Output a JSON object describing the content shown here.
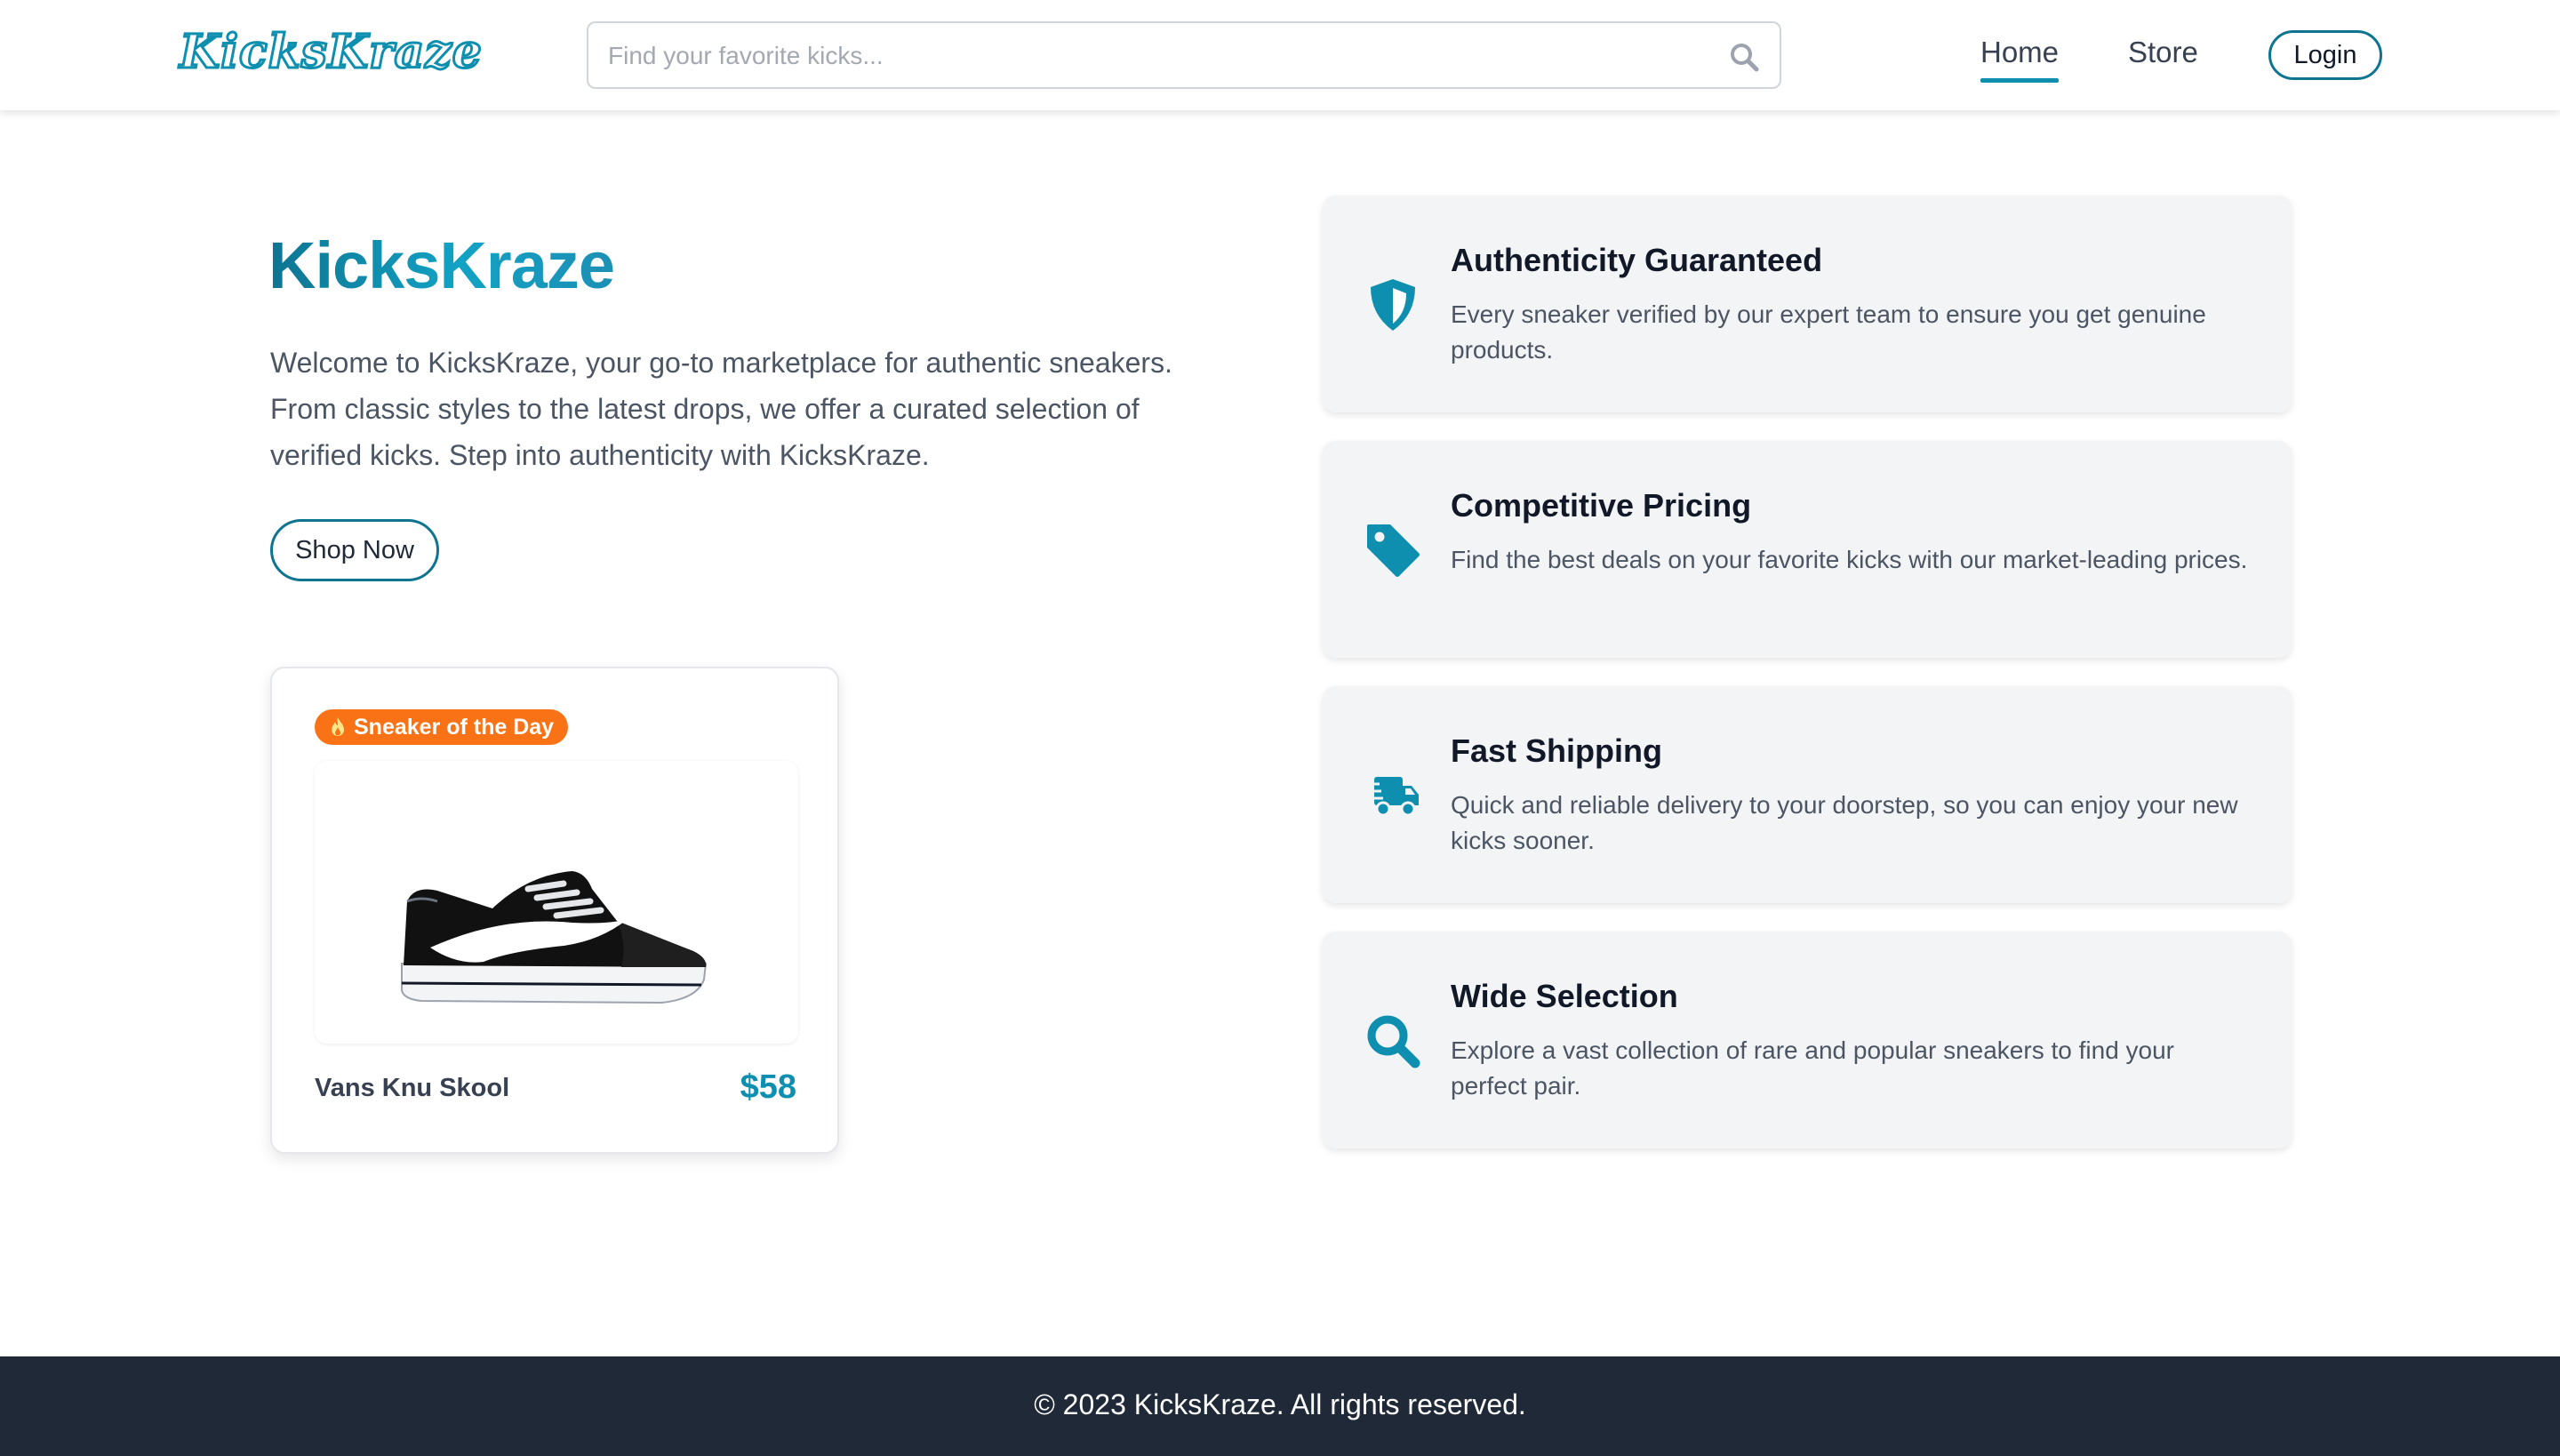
{
  "header": {
    "logo": "KicksKraze",
    "search_placeholder": "Find your favorite kicks...",
    "nav": {
      "home": "Home",
      "store": "Store"
    },
    "login_label": "Login",
    "accent_color": "#0e8fb0"
  },
  "hero": {
    "title": "KicksKraze",
    "description": "Welcome to KicksKraze, your go-to marketplace for authentic sneakers. From classic styles to the latest drops, we offer a curated selection of verified kicks. Step into authenticity with KicksKraze.",
    "cta_label": "Shop Now"
  },
  "sneaker_of_day": {
    "badge": "Sneaker of the Day",
    "badge_color": "#f97316",
    "name": "Vans Knu Skool",
    "price": "$58"
  },
  "features": [
    {
      "icon": "shield-icon",
      "title": "Authenticity Guaranteed",
      "description": "Every sneaker verified by our expert team to ensure you get genuine products."
    },
    {
      "icon": "tag-icon",
      "title": "Competitive Pricing",
      "description": "Find the best deals on your favorite kicks with our market-leading prices."
    },
    {
      "icon": "truck-icon",
      "title": "Fast Shipping",
      "description": "Quick and reliable delivery to your doorstep, so you can enjoy your new kicks sooner."
    },
    {
      "icon": "search-icon",
      "title": "Wide Selection",
      "description": "Explore a vast collection of rare and popular sneakers to find your perfect pair."
    }
  ],
  "footer": {
    "copyright": "© 2023 KicksKraze. All rights reserved."
  }
}
